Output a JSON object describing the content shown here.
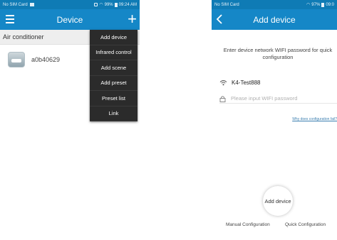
{
  "left_screen": {
    "status": {
      "carrier": "No SIM Card",
      "battery": "99%",
      "time": "09:24 AM"
    },
    "header": {
      "title": "Device",
      "menu_icon": "hamburger-menu-icon",
      "add_icon": "plus-icon"
    },
    "section": {
      "label": "Air conditioner"
    },
    "devices": [
      {
        "name": "a0b40629",
        "icon": "air-conditioner-icon"
      }
    ],
    "dropdown": {
      "items": [
        {
          "label": "Add device"
        },
        {
          "label": "Infrared control"
        },
        {
          "label": "Add scene"
        },
        {
          "label": "Add preset"
        },
        {
          "label": "Preset list"
        },
        {
          "label": "Link"
        }
      ]
    }
  },
  "right_screen": {
    "status": {
      "carrier": "No SIM Card",
      "battery": "97%",
      "time": "09:0"
    },
    "header": {
      "title": "Add device",
      "back_icon": "chevron-left-icon"
    },
    "instruction": "Enter device network WIFI password for quick configuration",
    "wifi": {
      "ssid": "K4-Test888",
      "icon": "wifi-icon"
    },
    "password": {
      "placeholder": "Please input WIFI password",
      "icon": "lock-icon"
    },
    "help_link": "Why does configuration fail?",
    "add_button": "Add device",
    "tabs": {
      "manual": "Manual Configuration",
      "quick": "Quick Configuration"
    }
  },
  "colors": {
    "statusbar": "#0f7bb5",
    "appbar": "#1587c7",
    "dropdown_bg": "#2b2b2b",
    "link": "#3c7fb0"
  }
}
